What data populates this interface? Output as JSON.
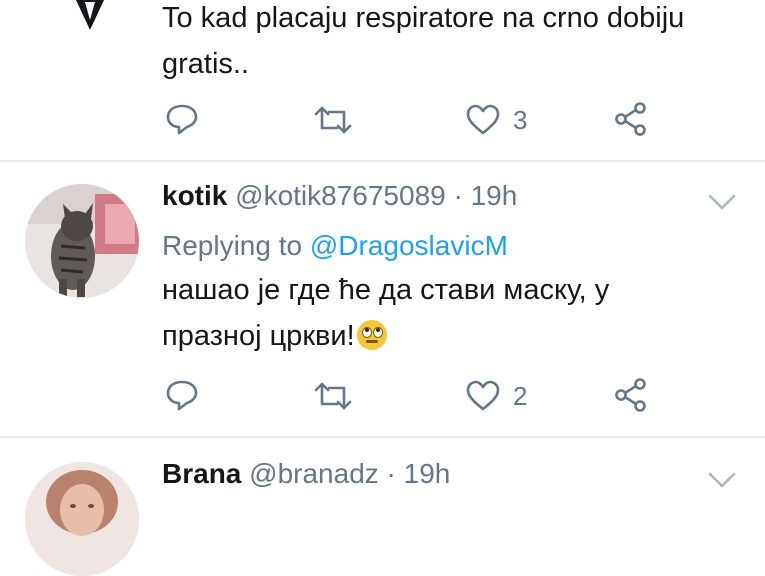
{
  "tweet1": {
    "text_line1": "To kad placaju respiratore na crno dobiju",
    "text_line2": "gratis..",
    "actions": {
      "like_count": "3"
    }
  },
  "tweet2": {
    "name": "kotik",
    "handle": "@kotik87675089",
    "separator": "·",
    "time": "19h",
    "replying_prefix": "Replying to ",
    "replying_to": "@DragoslavicM",
    "text_line1": "нашао је где ће да стави маску, у",
    "text_line2": "празној цркви!",
    "emoji": "face-with-rolling-eyes",
    "actions": {
      "like_count": "2"
    }
  },
  "tweet3": {
    "name": "Brana",
    "handle": "@branadz",
    "separator": "·",
    "time": "19h"
  },
  "colors": {
    "text": "#14171a",
    "secondary": "#657786",
    "link": "#1da1f2",
    "divider": "#e6ecf0"
  }
}
